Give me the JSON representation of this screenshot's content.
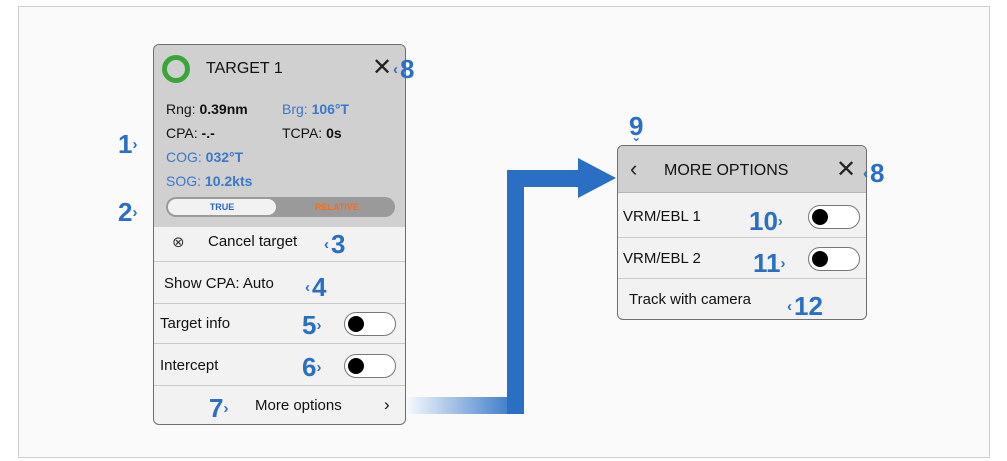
{
  "target_panel": {
    "title": "TARGET 1",
    "rng_label": "Rng:",
    "rng_value": "0.39nm",
    "brg_label": "Brg:",
    "brg_value": "106°T",
    "cpa_label": "CPA:",
    "cpa_value": "-.-",
    "tcpa_label": "TCPA:",
    "tcpa_value": "0s",
    "cog_label": "COG:",
    "cog_value": "032°T",
    "sog_label": "SOG:",
    "sog_value": "10.2kts",
    "mode_true": "TRUE",
    "mode_relative": "RELATIVE",
    "cancel_target": "Cancel target",
    "show_cpa": "Show CPA: Auto",
    "target_info": "Target info",
    "intercept": "Intercept",
    "more_options": "More options"
  },
  "more_panel": {
    "title": "MORE OPTIONS",
    "vrm_ebl_1": "VRM/EBL 1",
    "vrm_ebl_2": "VRM/EBL 2",
    "track_camera": "Track with camera"
  },
  "callouts": {
    "c1": "1",
    "c2": "2",
    "c3": "3",
    "c4": "4",
    "c5": "5",
    "c6": "6",
    "c7": "7",
    "c8": "8",
    "c9": "9",
    "c10": "10",
    "c11": "11",
    "c12": "12"
  },
  "icons": {
    "target_ring": "green-ring-icon",
    "close": "close-icon",
    "cancel": "circle-x-icon",
    "chevron_right": "chevron-right-icon",
    "back": "chevron-left-icon"
  },
  "colors": {
    "accent_blue": "#2a6fc4",
    "ring_green": "#3aa63a",
    "relative_orange": "#f26f22",
    "true_blue": "#2d66c2"
  }
}
